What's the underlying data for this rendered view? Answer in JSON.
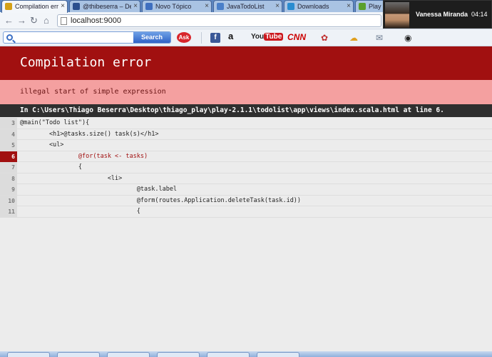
{
  "browser": {
    "tabs": [
      {
        "label": "Compilation erro",
        "favicon_color": "#d4a017",
        "active": true
      },
      {
        "label": "@thibeserra – De",
        "favicon_color": "#2b4f8e"
      },
      {
        "label": "Novo Tópico",
        "favicon_color": "#3f6fbf"
      },
      {
        "label": "JavaTodoList",
        "favicon_color": "#4a7fc9"
      },
      {
        "label": "Downloads",
        "favicon_color": "#2a8cd0"
      },
      {
        "label": "Play F",
        "favicon_color": "#5aa02c"
      }
    ],
    "address_bar": {
      "url": "localhost:9000"
    },
    "search_button_label": "Search"
  },
  "notification": {
    "name": "Vanessa Miranda",
    "time": "04:14"
  },
  "bookmarks": {
    "ask_label": "Ask",
    "facebook_label": "f",
    "amazon_label": "a",
    "youtube_label_1": "You",
    "youtube_label_2": "Tube",
    "cnn_label": "CNN"
  },
  "page": {
    "title": "Compilation error",
    "message": "illegal start of simple expression",
    "file_info": "In C:\\Users\\Thiago Beserra\\Desktop\\thiago_play\\play-2.1.1\\todolist\\app\\views\\index.scala.html at line 6.",
    "error_line": 6,
    "code_lines": [
      {
        "number": "3",
        "text": "@main(\"Todo list\"){"
      },
      {
        "number": "4",
        "text": "        <h1>@tasks.size() task(s)</h1>"
      },
      {
        "number": "5",
        "text": "        <ul>"
      },
      {
        "number": "6",
        "text": "                @for(task <- tasks)"
      },
      {
        "number": "7",
        "text": "                {"
      },
      {
        "number": "8",
        "text": "                        <li>"
      },
      {
        "number": "9",
        "text": "                                @task.label"
      },
      {
        "number": "10",
        "text": "                                @form(routes.Application.deleteTask(task.id))"
      },
      {
        "number": "11",
        "text": "                                {"
      }
    ]
  },
  "colors": {
    "header_bg": "#a11010",
    "message_bg": "#f4a0a0",
    "file_bar_bg": "#2f2f2f"
  }
}
